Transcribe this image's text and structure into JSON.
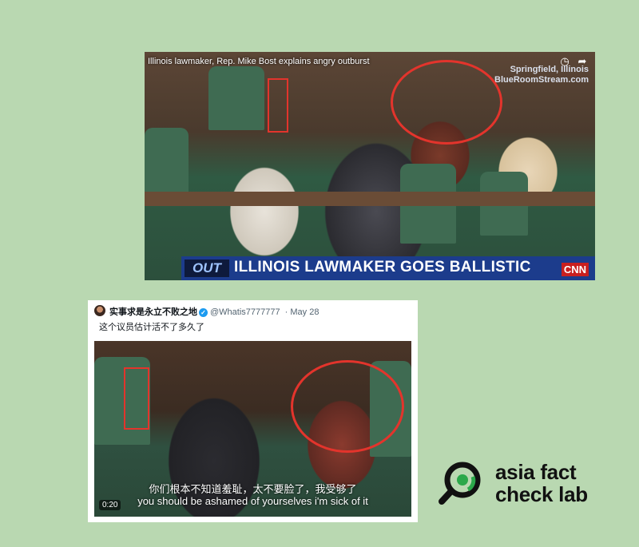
{
  "top_video": {
    "title": "Illinois lawmaker, Rep. Mike Bost explains angry outburst",
    "watermark_line1": "Springfield, Illinois",
    "watermark_line2": "BlueRoomStream.com",
    "banner_tag": "OUT",
    "banner_text": "ILLINOIS LAWMAKER GOES BALLISTIC",
    "network": "CNN",
    "clock_icon": "clock-icon",
    "share_icon": "share-icon"
  },
  "tweet": {
    "display_name": "实事求是永立不败之地",
    "handle": "@Whatis7777777",
    "date": "· May 28",
    "text": "这个议员估计活不了多久了",
    "subtitle_zh": "你们根本不知道羞耻，太不要脸了，我受够了",
    "subtitle_en": "you should be ashamed of yourselves i'm sick of it",
    "timestamp": "0:20"
  },
  "logo": {
    "line1": "asia fact",
    "line2": "check lab",
    "accent": "#2ba84a"
  },
  "colors": {
    "background": "#b9d8b1",
    "annotation": "#e3342c",
    "banner": "#1c3c8c"
  }
}
